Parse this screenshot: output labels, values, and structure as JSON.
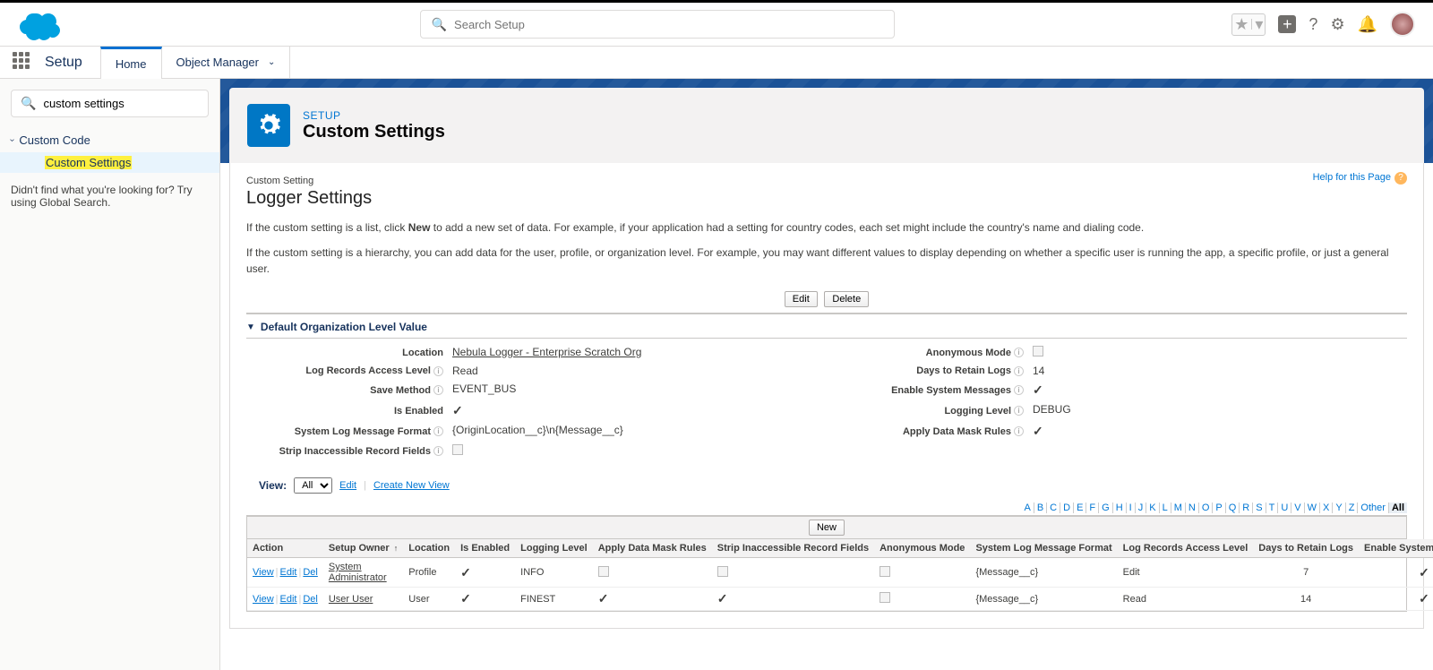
{
  "globalSearch": {
    "placeholder": "Search Setup"
  },
  "appNav": {
    "setup": "Setup",
    "home": "Home",
    "objMgr": "Object Manager"
  },
  "sidebar": {
    "searchValue": "custom settings",
    "node": "Custom Code",
    "child": "Custom Settings",
    "footer": "Didn't find what you're looking for? Try using Global Search."
  },
  "pageHeader": {
    "kicker": "SETUP",
    "title": "Custom Settings"
  },
  "helpLink": "Help for this Page",
  "record": {
    "crumb": "Custom Setting",
    "title": "Logger Settings",
    "intro1a": "If the custom setting is a list, click ",
    "intro1b": "New",
    "intro1c": " to add a new set of data. For example, if your application had a setting for country codes, each set might include the country's name and dialing code.",
    "intro2": "If the custom setting is a hierarchy, you can add data for the user, profile, or organization level. For example, you may want different values to display depending on whether a specific user is running the app, a specific profile, or just a general user."
  },
  "buttons": {
    "edit": "Edit",
    "delete": "Delete",
    "new": "New",
    "createView": "Create New View",
    "editView": "Edit"
  },
  "section": "Default Organization Level Value",
  "fields": {
    "location": {
      "label": "Location",
      "value": "Nebula Logger - Enterprise Scratch Org"
    },
    "anonMode": {
      "label": "Anonymous Mode"
    },
    "accessLevel": {
      "label": "Log Records Access Level",
      "value": "Read"
    },
    "daysRetain": {
      "label": "Days to Retain Logs",
      "value": "14"
    },
    "saveMethod": {
      "label": "Save Method",
      "value": "EVENT_BUS"
    },
    "sysMsg": {
      "label": "Enable System Messages"
    },
    "isEnabled": {
      "label": "Is Enabled"
    },
    "logLevel": {
      "label": "Logging Level",
      "value": "DEBUG"
    },
    "msgFormat": {
      "label": "System Log Message Format",
      "value": "{OriginLocation__c}\\n{Message__c}"
    },
    "dataMask": {
      "label": "Apply Data Mask Rules"
    },
    "stripFields": {
      "label": "Strip Inaccessible Record Fields"
    }
  },
  "view": {
    "label": "View:",
    "selected": "All"
  },
  "letters": [
    "A",
    "B",
    "C",
    "D",
    "E",
    "F",
    "G",
    "H",
    "I",
    "J",
    "K",
    "L",
    "M",
    "N",
    "O",
    "P",
    "Q",
    "R",
    "S",
    "T",
    "U",
    "V",
    "W",
    "X",
    "Y",
    "Z"
  ],
  "letterOther": "Other",
  "letterAll": "All",
  "table": {
    "headers": {
      "action": "Action",
      "owner": "Setup Owner",
      "location": "Location",
      "enabled": "Is Enabled",
      "logLevel": "Logging Level",
      "dataMask": "Apply Data Mask Rules",
      "strip": "Strip Inaccessible Record Fields",
      "anon": "Anonymous Mode",
      "msgFmt": "System Log Message Format",
      "access": "Log Records Access Level",
      "days": "Days to Retain Logs",
      "sysMsg": "Enable System Messages"
    },
    "actions": {
      "view": "View",
      "edit": "Edit",
      "del": "Del"
    },
    "rows": [
      {
        "owner": "System Administrator",
        "location": "Profile",
        "enabled": true,
        "logLevel": "INFO",
        "dataMask": false,
        "strip": false,
        "anon": false,
        "msgFmt": "{Message__c}",
        "access": "Edit",
        "days": "7",
        "sysMsg": true
      },
      {
        "owner": "User User",
        "location": "User",
        "enabled": true,
        "logLevel": "FINEST",
        "dataMask": true,
        "strip": true,
        "anon": false,
        "msgFmt": "{Message__c}",
        "access": "Read",
        "days": "14",
        "sysMsg": true
      }
    ]
  }
}
